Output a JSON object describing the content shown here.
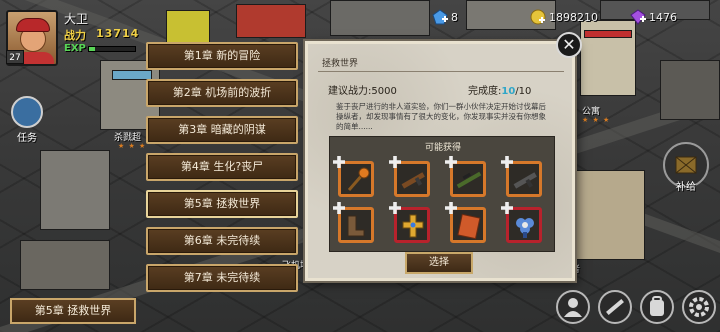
{
  "player": {
    "name": "大卫",
    "level": "27",
    "power_label": "战力",
    "power_value": "13714",
    "exp_label": "EXP",
    "exp_progress": 0.12
  },
  "resources": {
    "energy": "8",
    "coins": "1898210",
    "gems": "1476"
  },
  "map": {
    "task_label": "任务",
    "supply_label": "补给",
    "labels": [
      "杀戮超",
      "公寓",
      "飞机场",
      "者"
    ]
  },
  "chapters": [
    {
      "label": "第1章 新的冒险"
    },
    {
      "label": "第2章 机场前的波折"
    },
    {
      "label": "第3章 暗藏的阴谋"
    },
    {
      "label": "第4章 生化?丧尸"
    },
    {
      "label": "第5章 拯救世界"
    },
    {
      "label": "第6章 未完待续"
    },
    {
      "label": "第7章 未完待续"
    }
  ],
  "panel": {
    "title": "拯救世界",
    "power_req": "建议战力:5000",
    "completion_label": "完成度:",
    "completion_current": "10",
    "completion_total": "/10",
    "description": "鉴于丧尸进行的非人道实验，你们一群小伙伴决定开始讨伐幕后操纵者，却发现事情有了很大的变化，你发现事实并没有你想象的简单......",
    "rewards_title": "可能获得",
    "select_label": "选择",
    "items": [
      {
        "name": "staff-icon",
        "rarity": "orange"
      },
      {
        "name": "rifle-icon",
        "rarity": "orange"
      },
      {
        "name": "sniper-rifle-icon",
        "rarity": "orange"
      },
      {
        "name": "assault-rifle-icon",
        "rarity": "orange"
      },
      {
        "name": "boots-icon",
        "rarity": "orange"
      },
      {
        "name": "cross-amulet-icon",
        "rarity": "red"
      },
      {
        "name": "book-icon",
        "rarity": "orange"
      },
      {
        "name": "flower-badge-icon",
        "rarity": "red"
      }
    ]
  },
  "bottom": {
    "current_chapter": "第5章 拯救世界"
  },
  "colors": {
    "chapter_bg": "#4a3219",
    "chapter_border": "#c9a66a",
    "rarity_orange": "#d6782a",
    "rarity_red": "#b8222c",
    "completion_accent": "#2fa6c8"
  }
}
